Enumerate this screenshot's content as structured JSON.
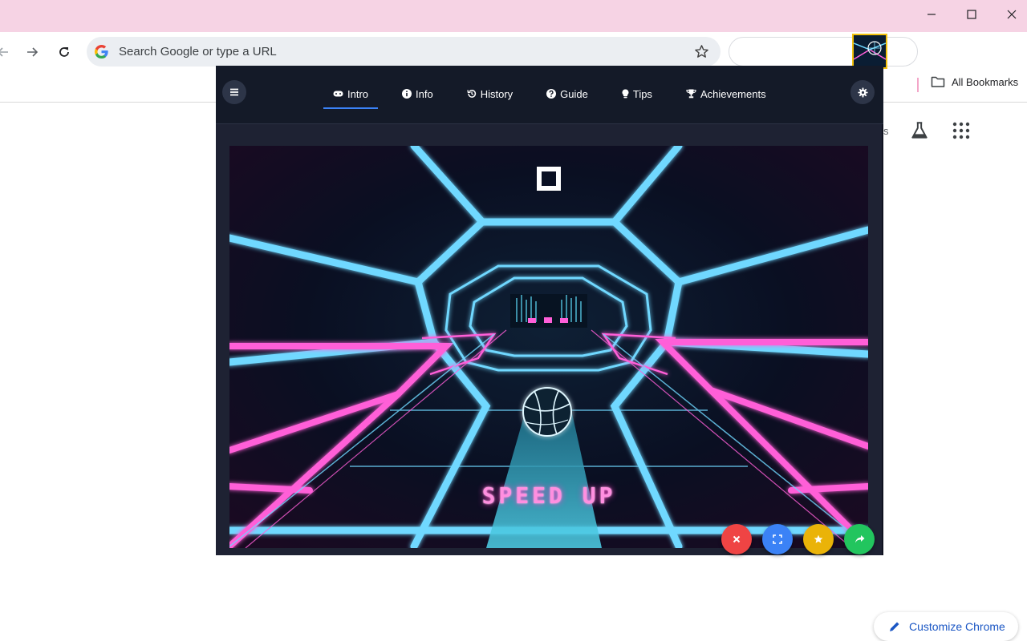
{
  "browser": {
    "omnibox_placeholder": "Search Google or type a URL",
    "bookmarks_all_label": "All Bookmarks",
    "customize_label": "Customize Chrome",
    "ntp_partial_text": "s"
  },
  "popup": {
    "tabs": [
      {
        "label": "Intro",
        "icon": "gamepad-icon",
        "active": true
      },
      {
        "label": "Info",
        "icon": "info-circle-icon",
        "active": false
      },
      {
        "label": "History",
        "icon": "history-icon",
        "active": false
      },
      {
        "label": "Guide",
        "icon": "question-circle-icon",
        "active": false
      },
      {
        "label": "Tips",
        "icon": "lightbulb-icon",
        "active": false
      },
      {
        "label": "Achievements",
        "icon": "trophy-icon",
        "active": false
      }
    ],
    "game": {
      "overlay_text": "SPEED UP"
    },
    "fab_colors": {
      "close": "#ef4444",
      "fullscreen": "#3b82f6",
      "favorite": "#eab308",
      "share": "#22c55e"
    }
  },
  "colors": {
    "titlebar": "#f6d3e4",
    "popup_bg": "#1e2233",
    "accent_blue": "#3b82f6",
    "neon_cyan": "#6fd8ff",
    "neon_pink": "#ff5fd8"
  }
}
